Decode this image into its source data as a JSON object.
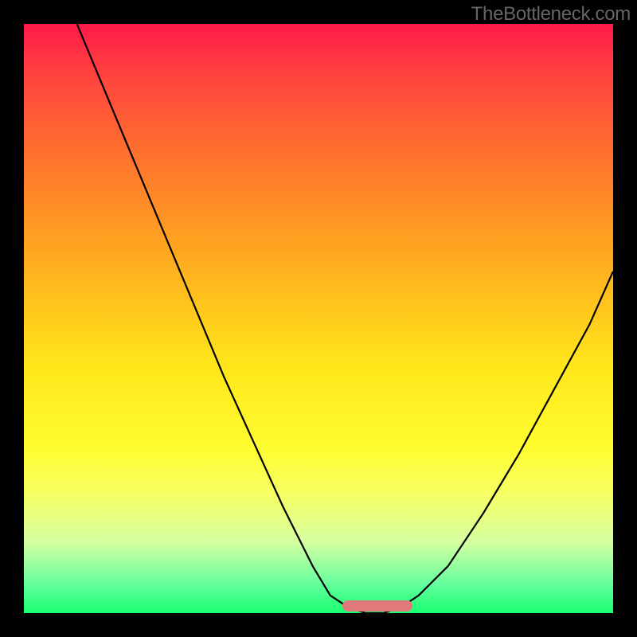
{
  "watermark": "TheBottleneck.com",
  "chart_data": {
    "type": "line",
    "title": "",
    "xlabel": "",
    "ylabel": "",
    "xlim": [
      0,
      100
    ],
    "ylim": [
      0,
      100
    ],
    "grid": false,
    "series": [
      {
        "name": "curve",
        "x": [
          9,
          14,
          19,
          24,
          29,
          34,
          39,
          44,
          49,
          52,
          55,
          58,
          61,
          64,
          67,
          72,
          78,
          84,
          90,
          96,
          100
        ],
        "y": [
          100,
          88,
          76,
          64,
          52,
          40,
          29,
          18,
          8,
          3,
          1,
          0,
          0,
          1,
          3,
          8,
          17,
          27,
          38,
          49,
          58
        ]
      }
    ],
    "annotations": [
      {
        "name": "optimal-range",
        "x_start": 54,
        "x_end": 66,
        "y": 0
      }
    ],
    "background_gradient": {
      "orientation": "vertical",
      "stops": [
        {
          "pos": 0.0,
          "color": "#ff1a4b"
        },
        {
          "pos": 0.2,
          "color": "#ff6a30"
        },
        {
          "pos": 0.58,
          "color": "#ffe61a"
        },
        {
          "pos": 0.88,
          "color": "#d4ffa0"
        },
        {
          "pos": 1.0,
          "color": "#18ff70"
        }
      ]
    }
  },
  "marker": {
    "left_pct": 54,
    "width_pct": 12
  }
}
